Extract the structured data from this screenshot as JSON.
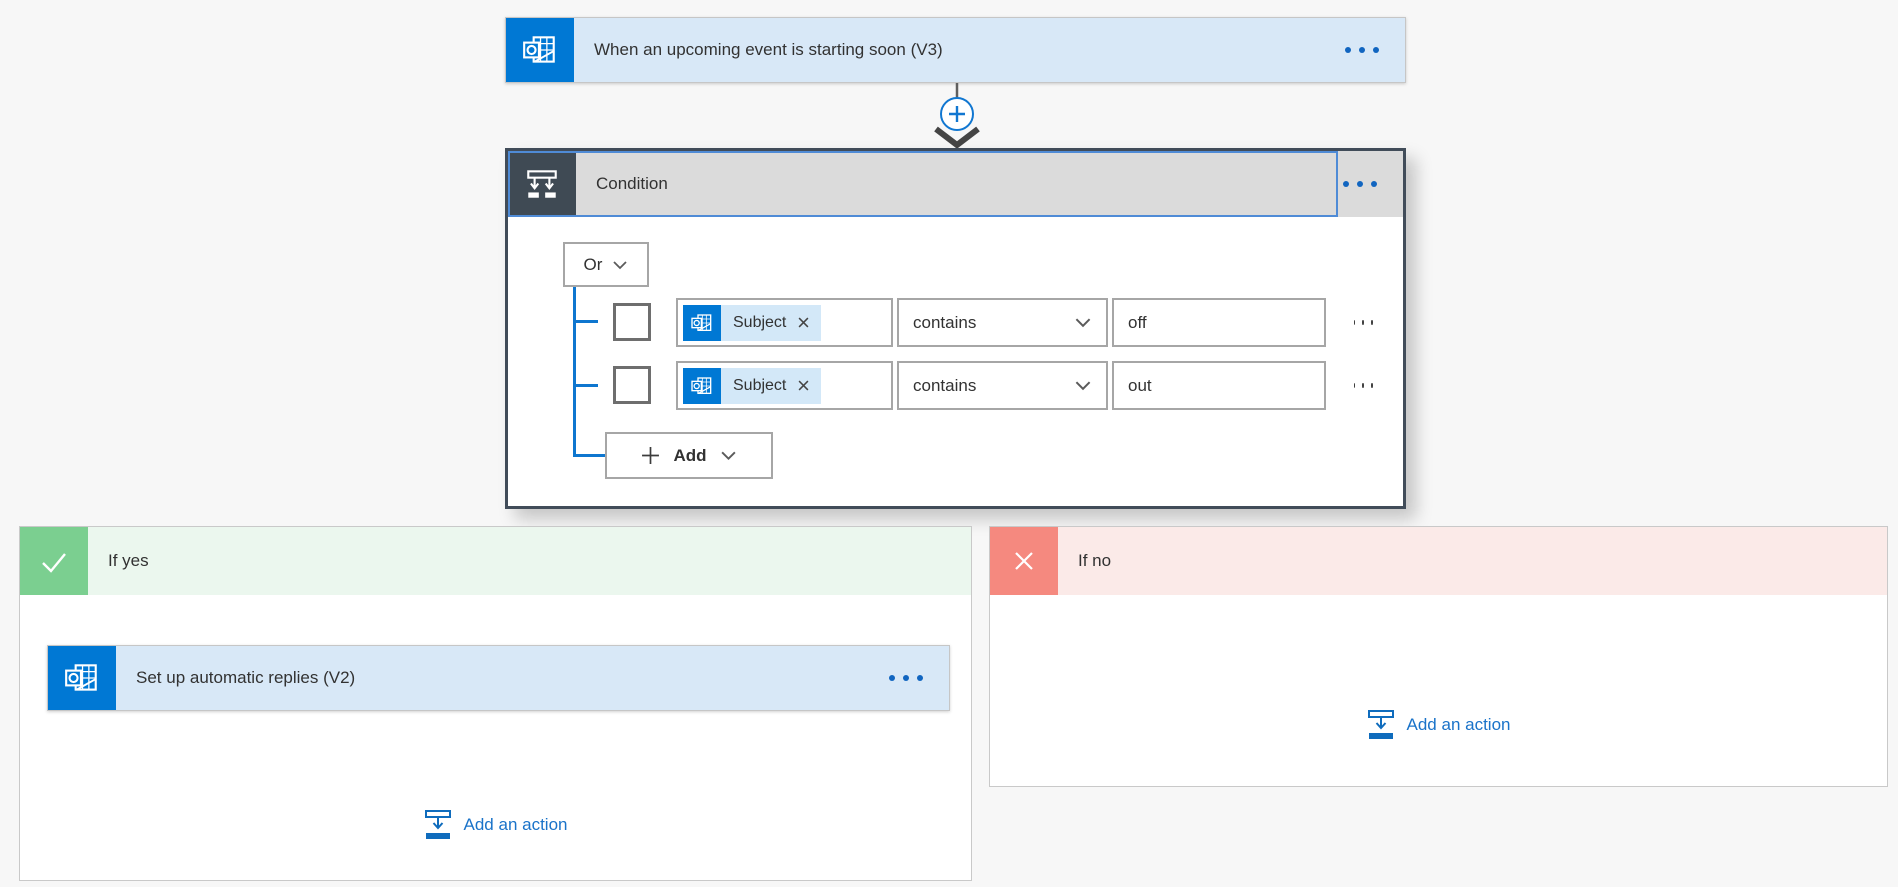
{
  "trigger_card": {
    "title": "When an upcoming event is starting soon (V3)"
  },
  "condition_card": {
    "title": "Condition",
    "operator_dropdown": "Or",
    "rows": [
      {
        "token": "Subject",
        "operator": "contains",
        "value": "off"
      },
      {
        "token": "Subject",
        "operator": "contains",
        "value": "out"
      }
    ],
    "add_button_label": "Add"
  },
  "if_yes": {
    "label": "If yes",
    "action_card": {
      "title": "Set up automatic replies (V2)"
    },
    "add_action_label": "Add an action"
  },
  "if_no": {
    "label": "If no",
    "add_action_label": "Add an action"
  },
  "icons": {
    "trigger": "outlook-calendar-icon",
    "condition": "condition-branch-icon",
    "if_yes": "checkmark-icon",
    "if_no": "cross-icon",
    "add_action": "add-action-icon"
  },
  "colors": {
    "outlook_blue": "#0078d4",
    "card_light_blue": "#d8e8f7",
    "condition_border": "#414c59",
    "focus_blue": "#4f8bd6",
    "tree_blue": "#0e76cf",
    "yes_green": "#7bcf90",
    "yes_header_bg": "#ebf7ee",
    "no_red": "#f5897f",
    "no_header_bg": "#fbeae8",
    "link_blue": "#1a73c9",
    "page_bg": "#f7f7f7"
  }
}
